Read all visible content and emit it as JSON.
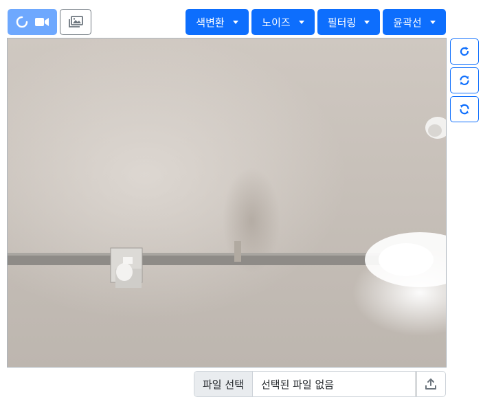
{
  "toolbar": {
    "camera_button_icon": "spinner-icon",
    "camera_icon": "video-camera-icon",
    "gallery_icon": "photo-gallery-icon",
    "menus": [
      {
        "label": "색변환"
      },
      {
        "label": "노이즈"
      },
      {
        "label": "필터링"
      },
      {
        "label": "윤곽선"
      }
    ]
  },
  "side_controls": [
    {
      "icon": "rotate-right-icon"
    },
    {
      "icon": "sync-icon"
    },
    {
      "icon": "refresh-icon"
    }
  ],
  "file_input": {
    "button_label": "파일 선택",
    "status_text": "선택된 파일 없음",
    "upload_icon": "upload-icon"
  },
  "colors": {
    "primary": "#0d6efd",
    "primary_disabled": "#6ea8fe",
    "secondary": "#6c757d"
  }
}
